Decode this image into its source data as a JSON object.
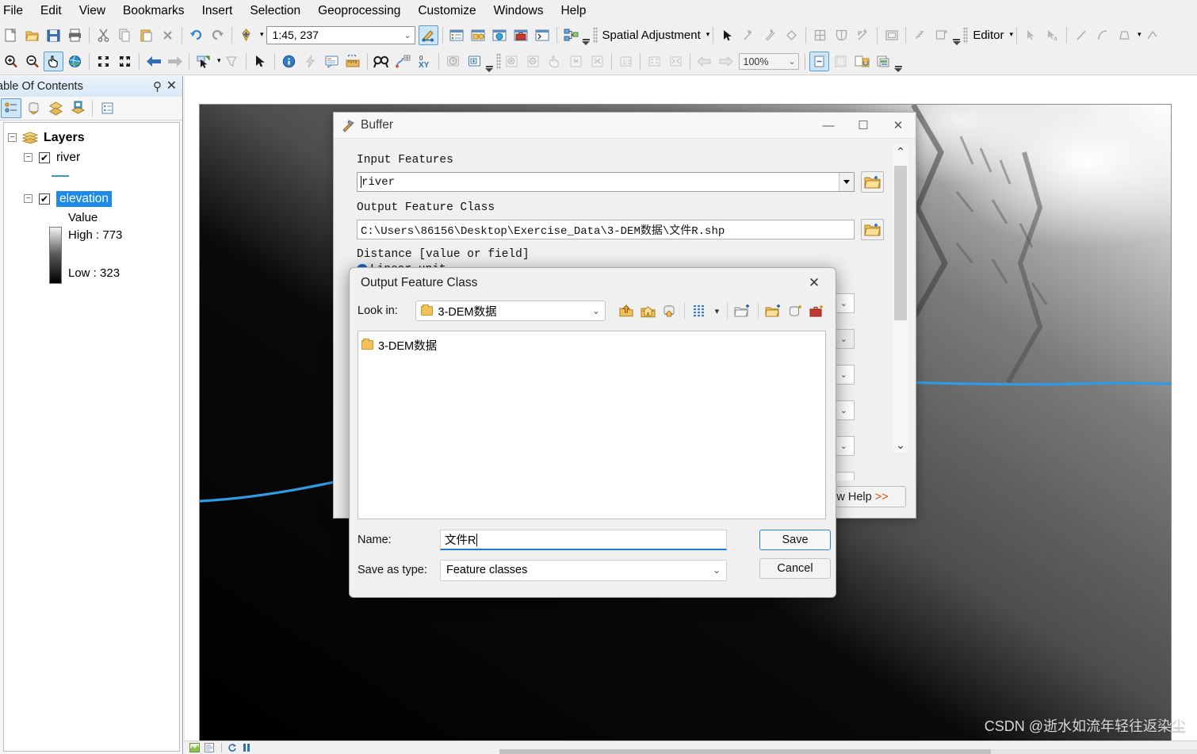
{
  "menu": {
    "items": [
      "File",
      "Edit",
      "View",
      "Bookmarks",
      "Insert",
      "Selection",
      "Geoprocessing",
      "Customize",
      "Windows",
      "Help"
    ]
  },
  "toolbar": {
    "scale": "1:45, 237",
    "zoom_percent": "100%",
    "spatial_adjustment_label": "Spatial Adjustment",
    "editor_label": "Editor",
    "icons_row1": [
      "new-map-icon",
      "open-icon",
      "save-icon",
      "print-icon",
      "cut-icon",
      "copy-icon",
      "paste-icon",
      "delete-icon",
      "undo-icon",
      "redo-icon",
      "add-data-icon",
      "scale-combo",
      "editor-toolbar-icon",
      "table-of-contents-icon",
      "catalog-icon",
      "search-icon",
      "toolbox-icon",
      "python-window-icon",
      "model-builder-icon"
    ],
    "icons_row2": [
      "zoom-in-icon",
      "zoom-out-icon",
      "pan-icon",
      "full-extent-icon",
      "fixed-zoom-in-icon",
      "fixed-zoom-out-icon",
      "go-back-icon",
      "go-forward-icon",
      "select-features-icon",
      "clear-selection-icon",
      "select-elements-icon",
      "identify-icon",
      "hyperlink-icon",
      "html-popup-icon",
      "measure-icon",
      "find-icon",
      "find-route-icon",
      "go-to-xy-icon",
      "time-slider-icon",
      "create-viewer-window-icon",
      "zoom-level-combo",
      "page-layout-icon"
    ]
  },
  "toc": {
    "title": "able Of Contents",
    "pin_icon": "pin-icon",
    "close_icon": "close-icon",
    "tool_icons": [
      "list-by-drawing-order-icon",
      "list-by-source-icon",
      "list-by-visibility-icon",
      "list-by-selection-icon",
      "options-icon"
    ],
    "root_label": "Layers",
    "layers": [
      {
        "name": "river",
        "checked": true,
        "symbol": "line-symbol-blue",
        "selected": false
      },
      {
        "name": "elevation",
        "checked": true,
        "symbol": "raster-ramp",
        "selected": true,
        "value_label": "Value",
        "high_label": "High : 773",
        "low_label": "Low : 323"
      }
    ]
  },
  "buffer_dialog": {
    "title": "Buffer",
    "icon": "hammer-tool-icon",
    "minimize_label": "—",
    "maximize_label": "☐",
    "close_label": "✕",
    "input_features_label": "Input Features",
    "input_features_value": "river",
    "output_feature_class_label": "Output Feature Class",
    "output_feature_class_value": "C:\\Users\\86156\\Desktop\\Exercise_Data\\3-DEM数据\\文件R.shp",
    "distance_label": "Distance [value or field]",
    "linear_unit_label": "Linear unit",
    "browse_icon": "browse-folder-icon",
    "help_button": "ow Help",
    "help_chevrons": ">>"
  },
  "save_dialog": {
    "title": "Output Feature Class",
    "close_label": "✕",
    "look_in_label": "Look in:",
    "look_in_value": "3-DEM数据",
    "toolbar_icons": [
      "up-one-level-icon",
      "home-folder-icon",
      "connect-folder-icon",
      "views-grid-icon",
      "views-dropdown-icon",
      "new-connection-icon",
      "new-folder-icon",
      "new-geodatabase-icon",
      "new-toolbox-icon"
    ],
    "items": [
      {
        "label": "3-DEM数据",
        "icon": "folder-icon"
      }
    ],
    "name_label": "Name:",
    "name_value": "文件R",
    "type_label": "Save as type:",
    "type_value": "Feature classes",
    "save_button": "Save",
    "cancel_button": "Cancel"
  },
  "statusbar": {
    "icons": [
      "data-view-icon",
      "layout-view-icon",
      "refresh-icon",
      "pause-drawing-icon"
    ]
  },
  "watermark": "CSDN @逝水如流年轻往返染尘",
  "colors": {
    "accent": "#1c8ae8",
    "river": "#2e9be5",
    "selection_blue": "#1c8ae8",
    "help_chevron": "#cc5500"
  }
}
